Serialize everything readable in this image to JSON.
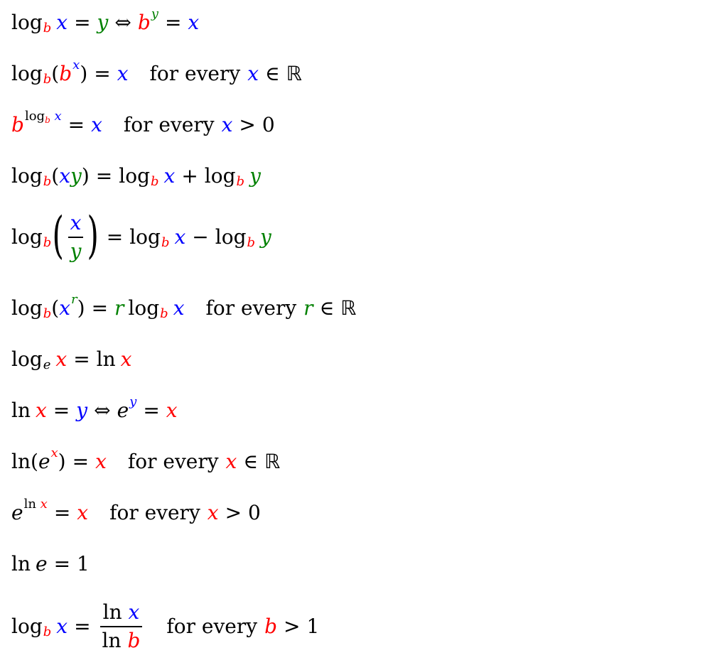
{
  "colors": {
    "red": "#ff0000",
    "blue": "#0000ff",
    "green": "#008000",
    "text": "#000000",
    "background": "#ffffff"
  },
  "text": {
    "log": "log",
    "ln": "ln",
    "for_every": "for every",
    "reals": "ℝ",
    "equals": "=",
    "iff": "⇔",
    "elem_of": "∈",
    "greater": ">",
    "plus": "+",
    "minus": "−",
    "zero": "0",
    "one": "1"
  },
  "formulas": [
    "log_b x = y ⇔ b^y = x",
    "log_b(b^x) = x  for every x ∈ ℝ",
    "b^(log_b x) = x  for every x > 0",
    "log_b(xy) = log_b x + log_b y",
    "log_b(x/y) = log_b x − log_b y",
    "log_b(x^r) = r log_b x  for every r ∈ ℝ",
    "log_e x = ln x",
    "ln x = y ⇔ e^y = x",
    "ln(e^x) = x  for every x ∈ ℝ",
    "e^(ln x) = x  for every x > 0",
    "ln e = 1",
    "log_b x = ln x / ln b  for every b > 1"
  ]
}
